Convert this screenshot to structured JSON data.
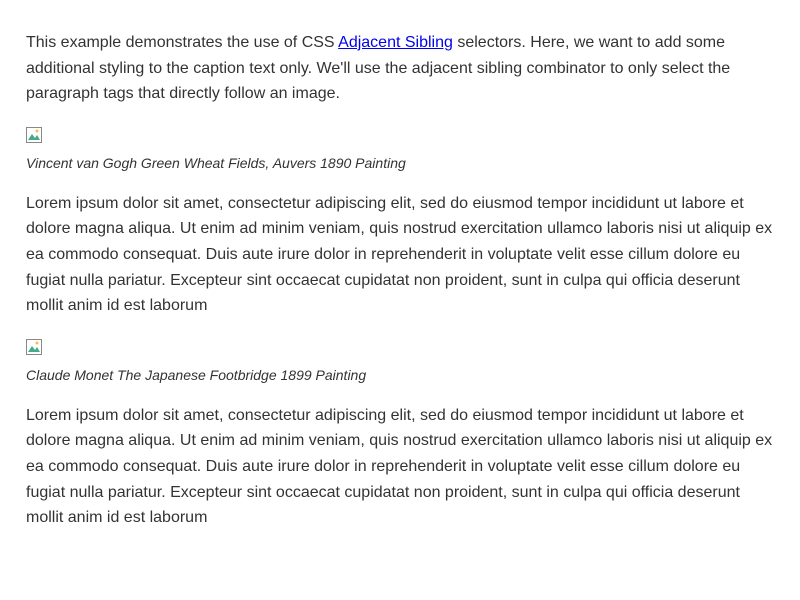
{
  "intro": {
    "pre": "This example demonstrates the use of CSS ",
    "link": "Adjacent Sibling",
    "post": " selectors. Here, we want to add some additional styling to the caption text only. We'll use the adjacent sibling combinator to only select the paragraph tags that directly follow an image."
  },
  "items": [
    {
      "caption": "Vincent van Gogh Green Wheat Fields, Auvers 1890 Painting",
      "body": "Lorem ipsum dolor sit amet, consectetur adipiscing elit, sed do eiusmod tempor incididunt ut labore et dolore magna aliqua. Ut enim ad minim veniam, quis nostrud exercitation ullamco laboris nisi ut aliquip ex ea commodo consequat. Duis aute irure dolor in reprehenderit in voluptate velit esse cillum dolore eu fugiat nulla pariatur. Excepteur sint occaecat cupidatat non proident, sunt in culpa qui officia deserunt mollit anim id est laborum"
    },
    {
      "caption": "Claude Monet The Japanese Footbridge 1899 Painting",
      "body": "Lorem ipsum dolor sit amet, consectetur adipiscing elit, sed do eiusmod tempor incididunt ut labore et dolore magna aliqua. Ut enim ad minim veniam, quis nostrud exercitation ullamco laboris nisi ut aliquip ex ea commodo consequat. Duis aute irure dolor in reprehenderit in voluptate velit esse cillum dolore eu fugiat nulla pariatur. Excepteur sint occaecat cupidatat non proident, sunt in culpa qui officia deserunt mollit anim id est laborum"
    }
  ]
}
